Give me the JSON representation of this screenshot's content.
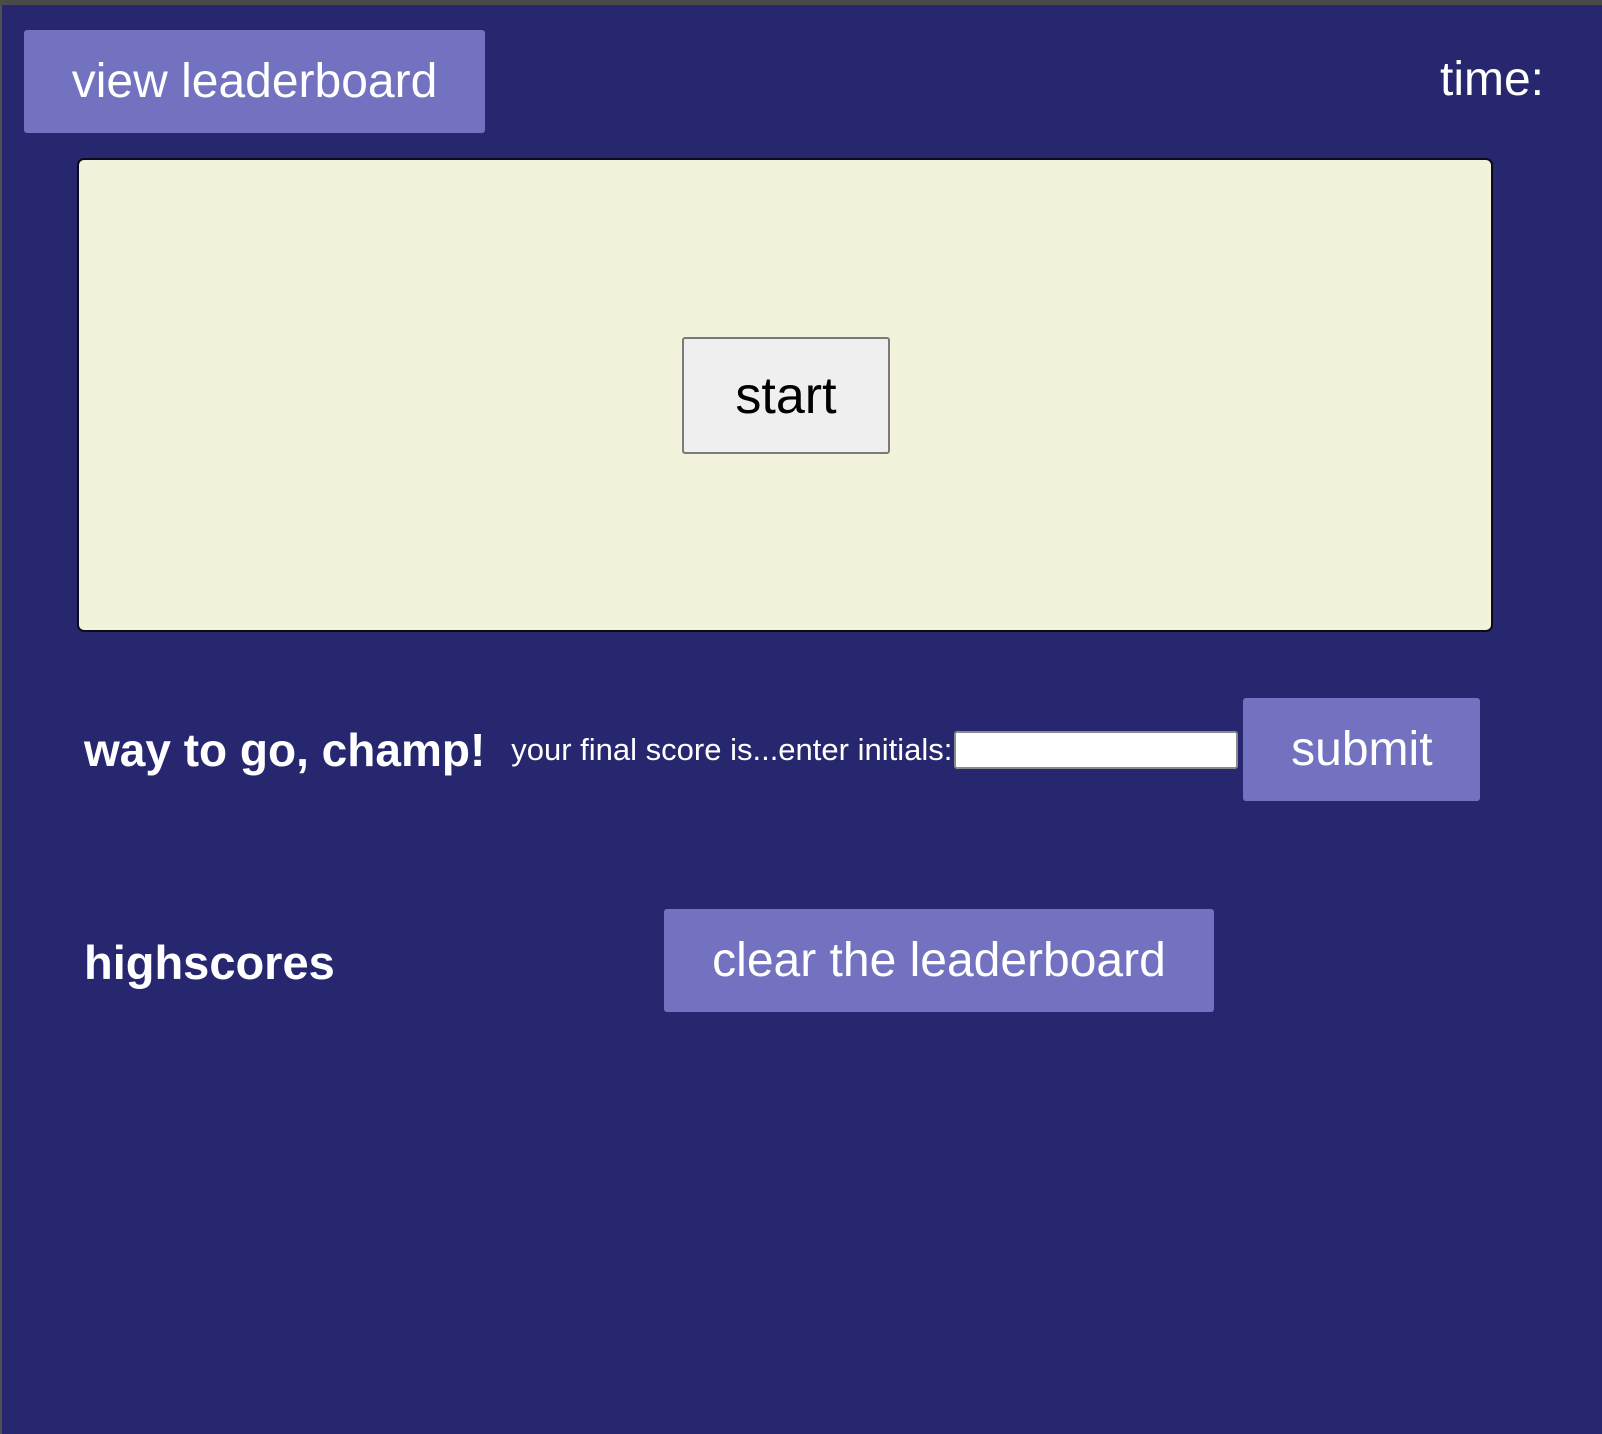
{
  "header": {
    "view_leaderboard_label": "view leaderboard",
    "timer_label": "time:"
  },
  "quiz": {
    "start_label": "start"
  },
  "result": {
    "heading": "way to go, champ!",
    "final_score_label": "your final score is...enter initials:",
    "initials_value": "",
    "submit_label": "submit"
  },
  "highscores": {
    "heading": "highscores",
    "clear_label": "clear the leaderboard"
  },
  "colors": {
    "background": "#272770",
    "button_purple": "#7272c1",
    "quiz_panel": "#f3f2da"
  }
}
